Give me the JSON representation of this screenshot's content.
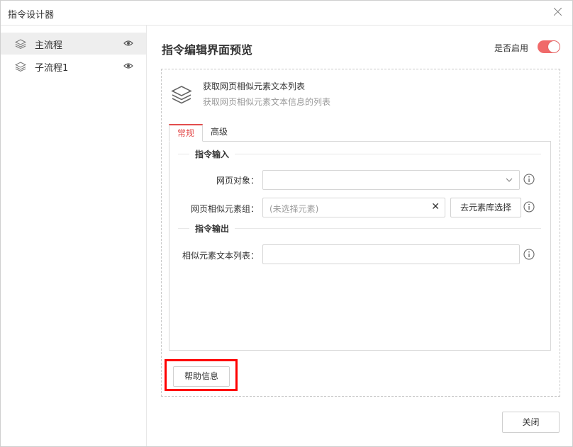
{
  "window": {
    "title": "指令设计器"
  },
  "sidebar": {
    "items": [
      {
        "label": "主流程",
        "active": true
      },
      {
        "label": "子流程1",
        "active": false
      }
    ]
  },
  "main": {
    "title": "指令编辑界面预览",
    "enable_label": "是否启用",
    "enabled": true,
    "command": {
      "name": "获取网页相似元素文本列表",
      "description": "获取网页相似元素文本信息的列表"
    },
    "tabs": [
      {
        "label": "常规",
        "active": true
      },
      {
        "label": "高级",
        "active": false
      }
    ],
    "input_section": {
      "title": "指令输入",
      "fields": [
        {
          "label": "网页对象：",
          "value": ""
        },
        {
          "label": "网页相似元素组：",
          "placeholder": "(未选择元素)",
          "button": "去元素库选择"
        }
      ]
    },
    "output_section": {
      "title": "指令输出",
      "fields": [
        {
          "label": "相似元素文本列表：",
          "value": ""
        }
      ]
    },
    "help_button": "帮助信息",
    "close_button": "关闭"
  },
  "colors": {
    "accent": "#e34d4d",
    "toggle_on": "#f06a6a",
    "highlight": "#ff0000"
  }
}
